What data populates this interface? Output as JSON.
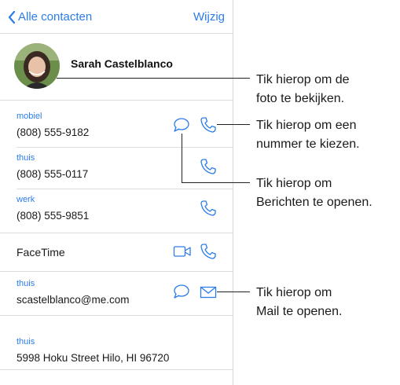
{
  "nav": {
    "back_label": "Alle contacten",
    "edit_label": "Wijzig"
  },
  "contact": {
    "name": "Sarah Castelblanco"
  },
  "phones": [
    {
      "label": "mobiel",
      "number": "(808) 555-9182"
    },
    {
      "label": "thuis",
      "number": "(808) 555-0117"
    },
    {
      "label": "werk",
      "number": "(808) 555-9851"
    }
  ],
  "facetime": {
    "label": "FaceTime"
  },
  "email": {
    "label": "thuis",
    "address": "scastelblanco@me.com"
  },
  "address": {
    "label": "thuis",
    "value": "5998 Hoku Street Hilo, HI 96720"
  },
  "annotations": {
    "photo": [
      "Tik hierop om de",
      "foto te bekijken."
    ],
    "call": [
      "Tik hierop om een",
      "nummer te kiezen."
    ],
    "messages": [
      "Tik hierop om",
      "Berichten te openen."
    ],
    "mail": [
      "Tik hierop om",
      "Mail te openen."
    ]
  },
  "colors": {
    "accent": "#2b7de9",
    "separator": "#dcdce0"
  }
}
